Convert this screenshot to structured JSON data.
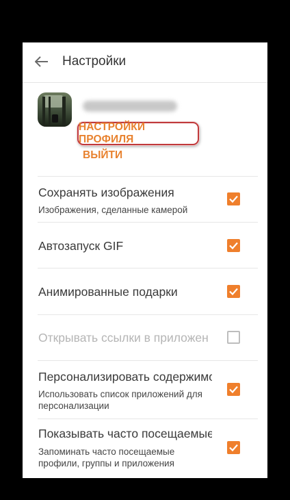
{
  "appbar": {
    "title": "Настройки"
  },
  "profile": {
    "settings_label": "НАСТРОЙКИ ПРОФИЛЯ",
    "logout_label": "ВЫЙТИ"
  },
  "settings": [
    {
      "title": "Сохранять изображения",
      "subtitle": "Изображения, сделанные камерой",
      "checked": true,
      "enabled": true
    },
    {
      "title": "Автозапуск GIF",
      "subtitle": "",
      "checked": true,
      "enabled": true
    },
    {
      "title": "Анимированные подарки",
      "subtitle": "",
      "checked": true,
      "enabled": true
    },
    {
      "title": "Открывать ссылки в приложен",
      "subtitle": "",
      "checked": false,
      "enabled": false
    },
    {
      "title": "Персонализировать содержимо",
      "subtitle": "Использовать список приложений для персонализации",
      "checked": true,
      "enabled": true
    },
    {
      "title": "Показывать часто посещаемые",
      "subtitle": "Запоминать часто посещаемые профили, группы и приложения",
      "checked": true,
      "enabled": true
    }
  ],
  "colors": {
    "accent": "#ef7f2c",
    "highlight": "#c0393b"
  }
}
